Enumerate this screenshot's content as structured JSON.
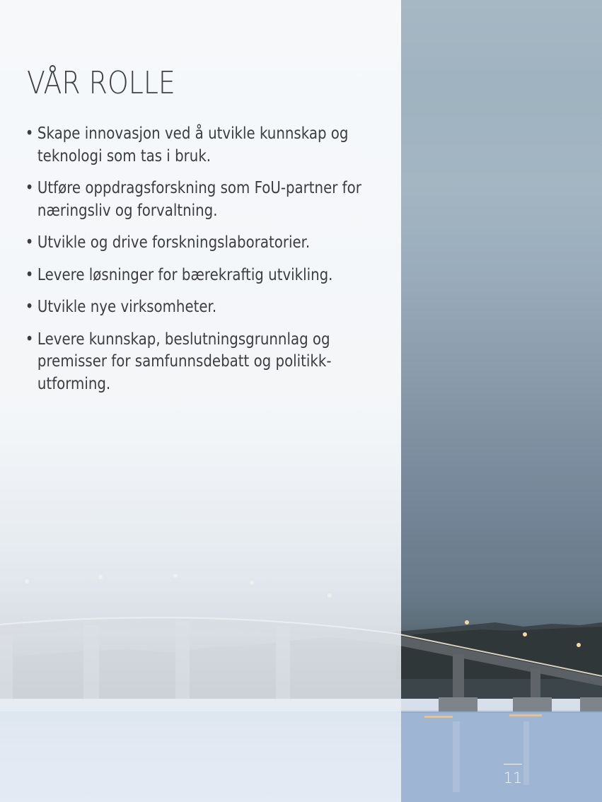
{
  "heading": "VÅR ROLLE",
  "roles": [
    "Skape innovasjon ved å utvikle kunnskap og teknologi som tas i bruk.",
    "Utføre oppdragsforskning som FoU-partner for næringsliv og forvaltning.",
    "Utvikle og drive forskningslaboratorier.",
    "Levere løsninger for bærekraftig utvikling.",
    "Utvikle nye virksomheter.",
    "Levere kunnskap, beslutningsgrunnlag og premisser for samfunnsdebatt og politikk-utforming."
  ],
  "page_number": "11",
  "colors": {
    "text": "#3b3d41",
    "sky": "#a3b6c2",
    "water": "#9db3d2"
  }
}
